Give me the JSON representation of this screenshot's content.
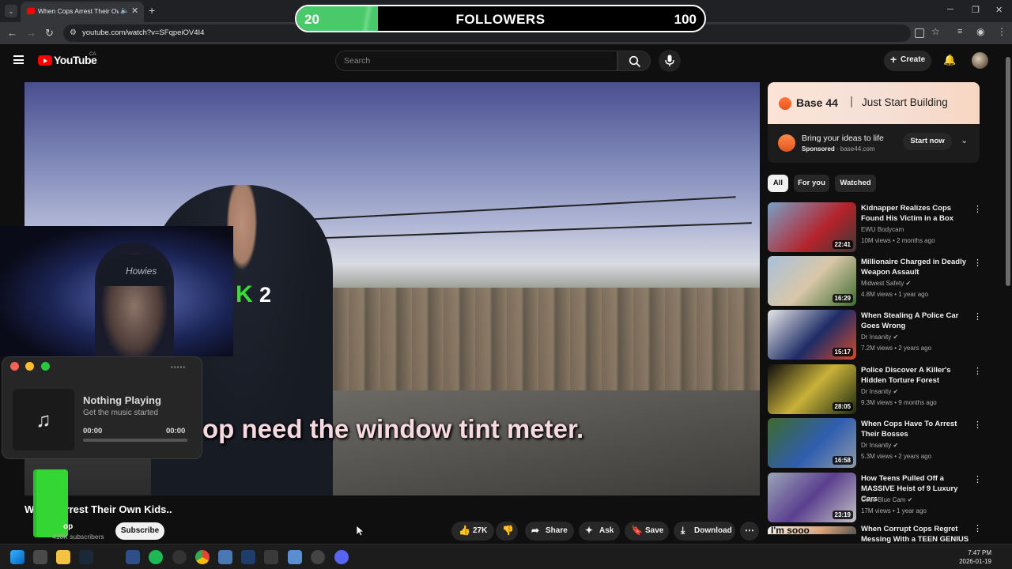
{
  "browser": {
    "tab_title": "When Cops Arrest Their Own",
    "url": "youtube.com/watch?v=SFqpeiOV4I4"
  },
  "overlay": {
    "followers_current": "20",
    "followers_label": "FOLLOWERS",
    "followers_goal": "100",
    "followers_fraction": 0.2
  },
  "youtube": {
    "logo_text": "YouTube",
    "country": "CA",
    "search_placeholder": "Search",
    "create_label": "Create"
  },
  "player": {
    "caption": "op need the window tint meter.",
    "k_label": "K",
    "k_num": "2"
  },
  "music": {
    "status": "Nothing Playing",
    "subtitle": "Get the music started",
    "time_start": "00:00",
    "time_end": "00:00"
  },
  "video": {
    "title": "Wh    ps Arrest Their Own Kids..",
    "channel": "op",
    "subscribers": "410K subscribers",
    "subscribe_label": "Subscribe",
    "likes": "27K",
    "share": "Share",
    "ask": "Ask",
    "save": "Save",
    "download": "Download"
  },
  "ad": {
    "brand": "Base 44",
    "tagline": "Just Start Building",
    "headline": "Bring your ideas to life",
    "sponsored": "Sponsored",
    "domain": "base44.com",
    "cta": "Start now"
  },
  "chips": [
    "All",
    "For you",
    "Watched"
  ],
  "recommendations": [
    {
      "title": "Kidnapper Realizes Cops Found His Victim in a Box",
      "channel": "EWU Bodycam",
      "meta": "10M views • 2 months ago",
      "duration": "22:41",
      "verified": false
    },
    {
      "title": "Millionaire Charged in Deadly Weapon Assault",
      "channel": "Midwest Safety",
      "meta": "4.8M views • 1 year ago",
      "duration": "16:29",
      "verified": true
    },
    {
      "title": "When Stealing A Police Car Goes Wrong",
      "channel": "Dr Insanity",
      "meta": "7.2M views • 2 years ago",
      "duration": "15:17",
      "verified": true
    },
    {
      "title": "Police Discover A Killer's Hidden Torture Forest",
      "channel": "Dr Insanity",
      "meta": "9.3M views • 9 months ago",
      "duration": "28:05",
      "verified": true
    },
    {
      "title": "When Cops Have To Arrest Their Bosses",
      "channel": "Dr Insanity",
      "meta": "5.3M views • 2 years ago",
      "duration": "16:58",
      "verified": true
    },
    {
      "title": "How Teens Pulled Off a MASSIVE Heist of 9 Luxury Cars",
      "channel": "Code Blue Cam",
      "meta": "17M views • 1 year ago",
      "duration": "23:19",
      "verified": true
    },
    {
      "title": "When Corrupt Cops Regret Messing With a TEEN GENIUS",
      "channel": "",
      "meta": "",
      "duration": "",
      "thumb_text": "I'm sooo",
      "verified": false
    }
  ],
  "taskbar": {
    "time": "7:47 PM",
    "date": "2026-01-19"
  }
}
